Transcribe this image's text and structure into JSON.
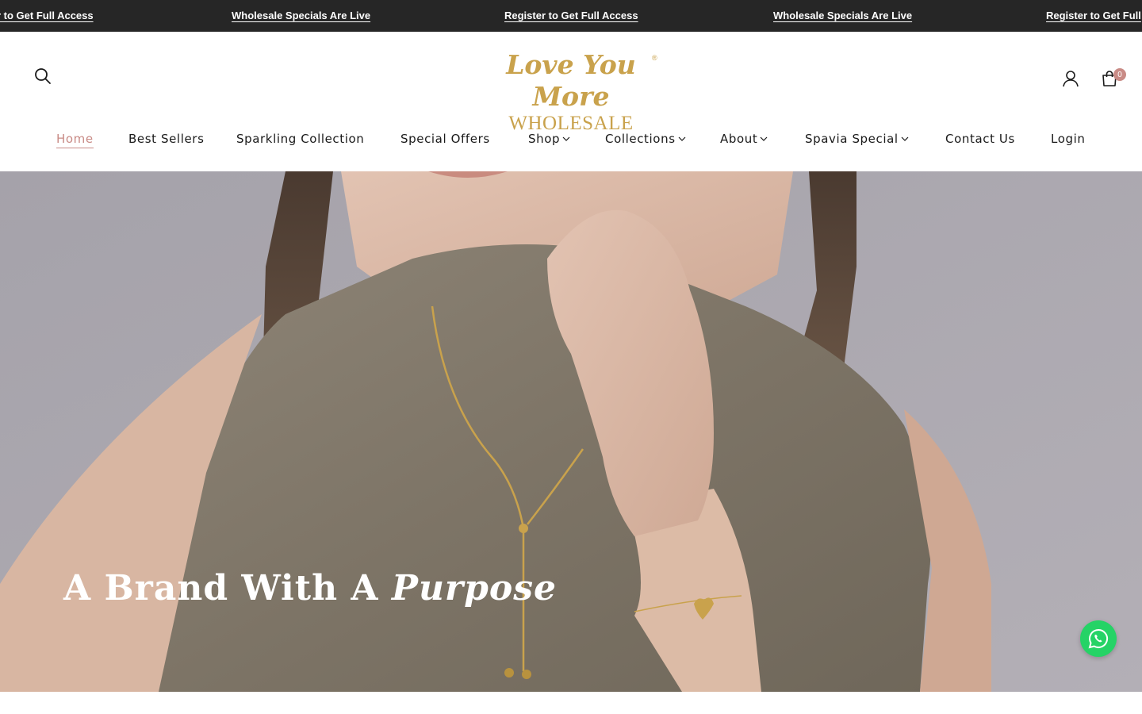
{
  "announcement": {
    "items": [
      "r to Get Full Access",
      "Wholesale Specials Are Live",
      "Register to Get Full Access",
      "Wholesale Specials Are Live",
      "Register to Get Full"
    ]
  },
  "header": {
    "logo": {
      "script": "Love You More",
      "registered": "®",
      "subline": "WHOLESALE"
    },
    "cart_count": "0"
  },
  "nav": {
    "items": [
      {
        "label": "Home",
        "active": true,
        "dropdown": false
      },
      {
        "label": "Best Sellers",
        "active": false,
        "dropdown": false
      },
      {
        "label": "Sparkling Collection",
        "active": false,
        "dropdown": false
      },
      {
        "label": "Special Offers",
        "active": false,
        "dropdown": false
      },
      {
        "label": "Shop",
        "active": false,
        "dropdown": true
      },
      {
        "label": "Collections",
        "active": false,
        "dropdown": true
      },
      {
        "label": "About",
        "active": false,
        "dropdown": true
      },
      {
        "label": "Spavia Special",
        "active": false,
        "dropdown": true
      },
      {
        "label": "Contact Us",
        "active": false,
        "dropdown": false
      },
      {
        "label": "Login",
        "active": false,
        "dropdown": false
      }
    ]
  },
  "hero": {
    "title_main": "A Brand With A ",
    "title_emphasis": "Purpose"
  },
  "icons": {
    "search": "search-icon",
    "account": "user-icon",
    "cart": "shopping-bag-icon",
    "chevron": "chevron-down-icon",
    "whatsapp": "whatsapp-icon"
  },
  "colors": {
    "announcement_bg": "#262626",
    "brand_gold": "#c9a24c",
    "accent_rose": "#c98b86",
    "whatsapp_green": "#25d366"
  }
}
